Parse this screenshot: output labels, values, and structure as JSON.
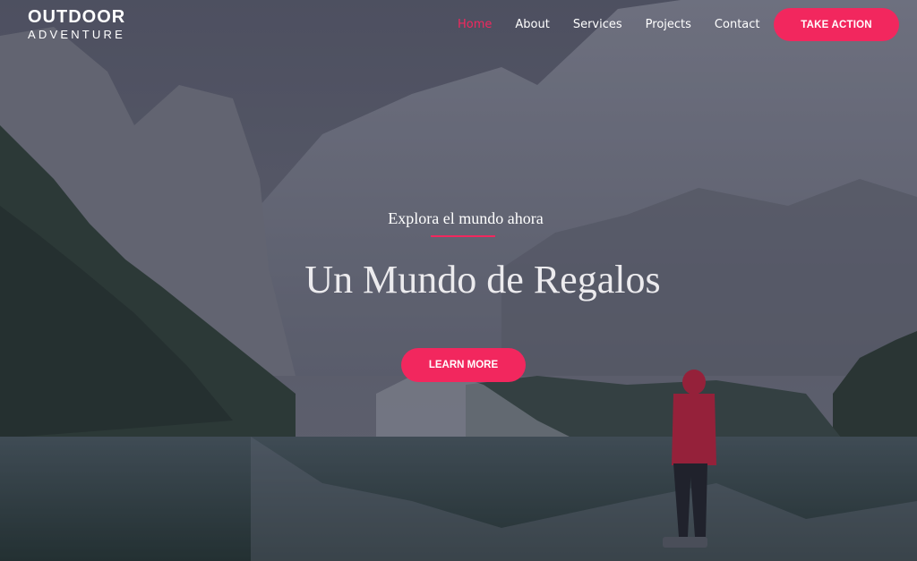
{
  "brand": {
    "name": "OUTDOOR",
    "tagline": "ADVENTURE"
  },
  "nav": {
    "items": [
      {
        "label": "Home",
        "active": true
      },
      {
        "label": "About",
        "active": false
      },
      {
        "label": "Services",
        "active": false
      },
      {
        "label": "Projects",
        "active": false
      },
      {
        "label": "Contact",
        "active": false
      }
    ],
    "cta_label": "TAKE ACTION"
  },
  "hero": {
    "kicker": "Explora el mundo ahora",
    "title": "Un Mundo de Regalos",
    "button_label": "LEARN MORE",
    "background_image": "mountain-lake-hiker-photo"
  },
  "colors": {
    "accent": "#f2275e",
    "text": "#ffffff"
  }
}
